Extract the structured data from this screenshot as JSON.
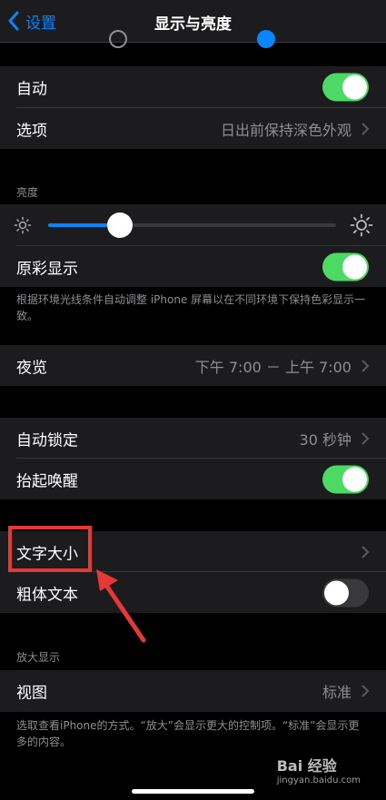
{
  "nav": {
    "back_label": "设置",
    "title": "显示与亮度"
  },
  "rows": {
    "auto": {
      "label": "自动",
      "toggle": true
    },
    "options": {
      "label": "选项",
      "value": "日出前保持深色外观"
    },
    "true_tone": {
      "label": "原彩显示",
      "toggle": true
    },
    "night_shift": {
      "label": "夜览",
      "value": "下午 7:00 － 上午 7:00"
    },
    "auto_lock": {
      "label": "自动锁定",
      "value": "30 秒钟"
    },
    "raise_to_wake": {
      "label": "抬起唤醒",
      "toggle": true
    },
    "text_size": {
      "label": "文字大小"
    },
    "bold_text": {
      "label": "粗体文本",
      "toggle": false
    },
    "view": {
      "label": "视图",
      "value": "标准"
    }
  },
  "brightness": {
    "header": "亮度",
    "level": 0.25
  },
  "true_tone_footnote": "根据环境光线条件自动调整 iPhone 屏幕以在不同环境下保持色彩显示一致。",
  "zoom": {
    "header": "放大显示",
    "footnote": "选取查看iPhone的方式。“放大”会显示更大的控制项。“标准”会显示更多的内容。"
  },
  "watermark": {
    "brand": "Bai  经验",
    "url": "jingyan.baidu.com"
  },
  "colors": {
    "accent": "#0a84ff",
    "toggle_on": "#4cd964",
    "highlight": "#e53935"
  }
}
